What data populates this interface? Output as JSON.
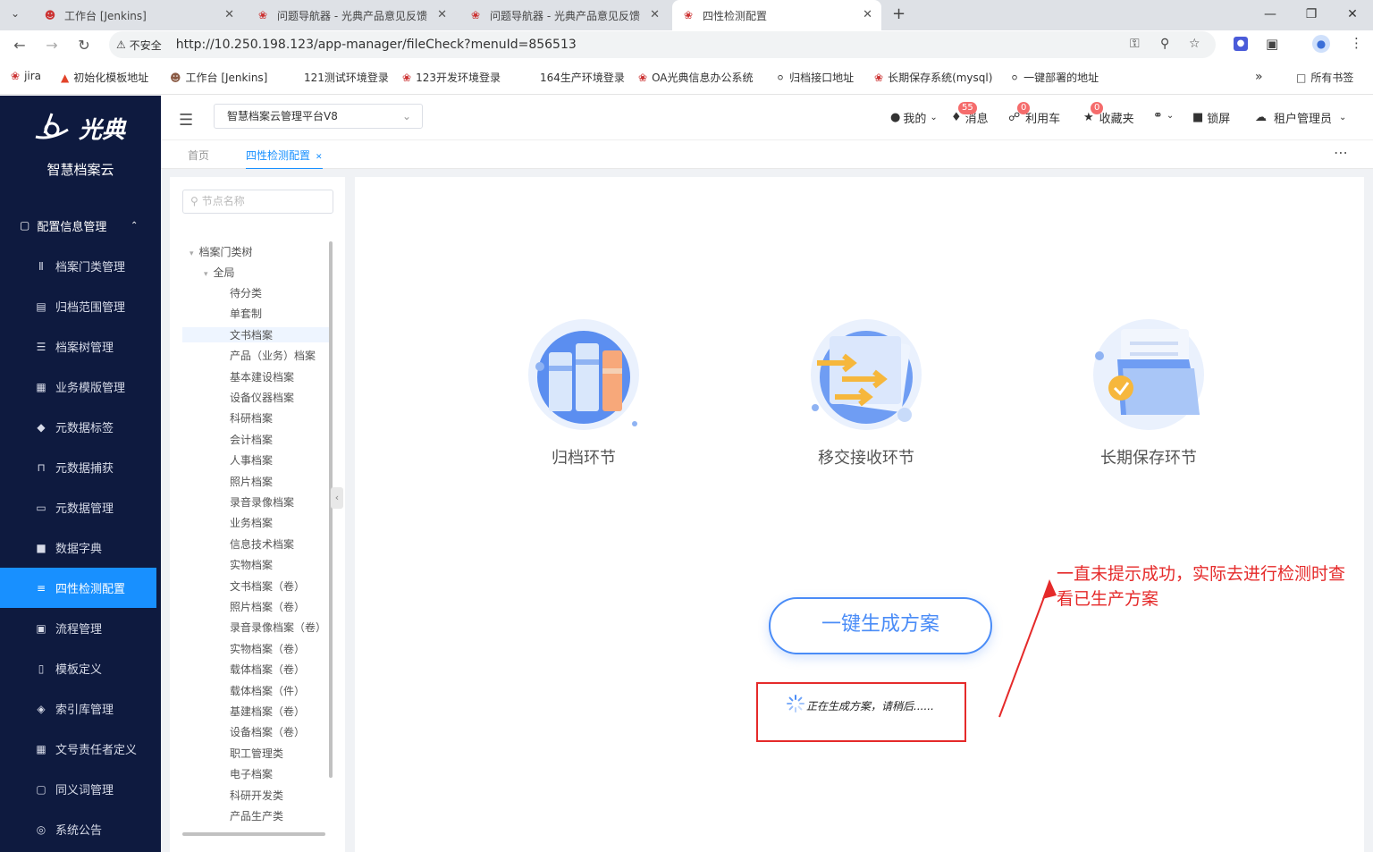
{
  "browser": {
    "tabs": [
      {
        "title": "工作台 [Jenkins]"
      },
      {
        "title": "问题导航器 - 光典产品意见反馈"
      },
      {
        "title": "问题导航器 - 光典产品意见反馈"
      },
      {
        "title": "四性检测配置"
      }
    ],
    "insecure_label": "不安全",
    "url": "http://10.250.198.123/app-manager/fileCheck?menuId=856513",
    "bookmarks": [
      "jira",
      "初始化模板地址",
      "工作台 [Jenkins]",
      "121测试环境登录",
      "123开发环境登录",
      "164生产环境登录",
      "OA光典信息办公系统",
      "归档接口地址",
      "长期保存系统(mysql)",
      "一键部署的地址"
    ],
    "all_bookmarks": "所有书签"
  },
  "sidebar": {
    "brand": "光典",
    "subtitle": "智慧档案云",
    "group_label": "配置信息管理",
    "items": [
      {
        "label": "档案门类管理",
        "icon": "books-icon"
      },
      {
        "label": "归档范围管理",
        "icon": "document-icon"
      },
      {
        "label": "档案树管理",
        "icon": "tree-icon"
      },
      {
        "label": "业务模版管理",
        "icon": "template-icon"
      },
      {
        "label": "元数据标签",
        "icon": "tag-icon"
      },
      {
        "label": "元数据捕获",
        "icon": "crop-icon"
      },
      {
        "label": "元数据管理",
        "icon": "card-icon"
      },
      {
        "label": "数据字典",
        "icon": "book-icon"
      },
      {
        "label": "四性检测配置",
        "icon": "sliders-icon",
        "active": true
      },
      {
        "label": "流程管理",
        "icon": "flow-icon"
      },
      {
        "label": "模板定义",
        "icon": "template-def-icon"
      },
      {
        "label": "索引库管理",
        "icon": "layers-icon"
      },
      {
        "label": "文号责任者定义",
        "icon": "grid-icon"
      },
      {
        "label": "同义词管理",
        "icon": "copy-icon"
      },
      {
        "label": "系统公告",
        "icon": "announce-icon"
      }
    ]
  },
  "header": {
    "platform": "智慧档案云管理平台V8",
    "mine": "我的",
    "messages": "消息",
    "messages_count": "55",
    "cart": "利用车",
    "cart_count": "0",
    "favorites": "收藏夹",
    "favorites_count": "0",
    "lock": "锁屏",
    "user": "租户管理员"
  },
  "page_tabs": {
    "home": "首页",
    "current": "四性检测配置"
  },
  "tree": {
    "search_placeholder": "节点名称",
    "root": "档案门类树",
    "global": "全局",
    "nodes": [
      "待分类",
      "单套制",
      "文书档案",
      "产品（业务）档案",
      "基本建设档案",
      "设备仪器档案",
      "科研档案",
      "会计档案",
      "人事档案",
      "照片档案",
      "录音录像档案",
      "业务档案",
      "信息技术档案",
      "实物档案",
      "文书档案（卷）",
      "照片档案（卷）",
      "录音录像档案（卷）",
      "实物档案（卷）",
      "载体档案（卷）",
      "载体档案（件）",
      "基建档案（卷）",
      "设备档案（卷）",
      "职工管理类",
      "电子档案",
      "科研开发类",
      "产品生产类"
    ],
    "selected": "文书档案"
  },
  "main": {
    "stages": [
      "归档环节",
      "移交接收环节",
      "长期保存环节"
    ],
    "generate_button": "一键生成方案",
    "loading_text": "正在生成方案，请稍后......",
    "annotation": "一直未提示成功，实际去进行检测时查看已生产方案"
  },
  "colors": {
    "sidebar_bg": "#0e1a3f",
    "accent": "#1890ff",
    "annotation_red": "#e52a2a"
  }
}
